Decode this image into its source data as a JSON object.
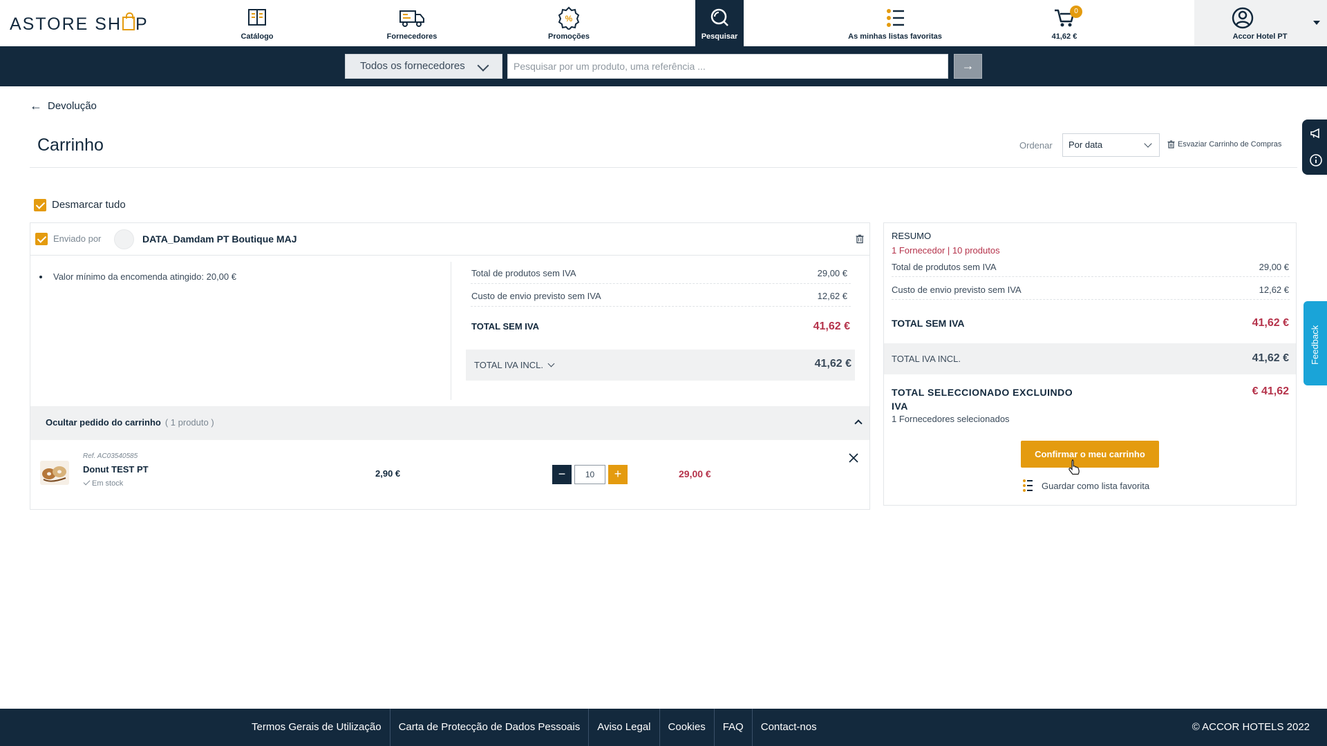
{
  "header": {
    "logo": "ASTORE SHOP",
    "nav": [
      {
        "label": "Catálogo",
        "icon": "catalog-book-icon"
      },
      {
        "label": "Fornecedores",
        "icon": "truck-icon"
      },
      {
        "label": "Promoções",
        "icon": "promo-badge-icon"
      },
      {
        "label": "Pesquisar",
        "icon": "search-icon",
        "active": true
      },
      {
        "label": "As minhas listas favoritas",
        "icon": "list-icon"
      },
      {
        "label": "41,62 €",
        "icon": "cart-icon",
        "badge": "0"
      }
    ],
    "account": {
      "label": "Accor Hotel PT",
      "icon": "user-circle-icon"
    }
  },
  "search": {
    "supplier_select": "Todos os fornecedores",
    "placeholder": "Pesquisar por um produto, uma referência ...",
    "value": "",
    "submit_icon": "arrow-right-icon"
  },
  "page": {
    "back_label": "Devolução",
    "title": "Carrinho",
    "sort_label": "Ordenar",
    "sort_value": "Por data",
    "empty_cart_label": "Esvaziar Carrinho de Compras",
    "select_all_label": "Desmarcar tudo"
  },
  "supplier_card": {
    "sent_by": "Enviado por",
    "supplier_name": "DATA_Damdam PT Boutique MAJ",
    "min_order_note": "Valor mínimo da encomenda atingido: 20,00 €",
    "rows": [
      {
        "label": "Total de produtos sem IVA",
        "value": "29,00 €"
      },
      {
        "label": "Custo de envio previsto sem IVA",
        "value": "12,62 €"
      }
    ],
    "total_label": "TOTAL SEM IVA",
    "total_value": "41,62 €",
    "vat_label": "TOTAL IVA INCL.",
    "vat_value": "41,62 €",
    "hide_label": "Ocultar pedido do carrinho",
    "hide_count": "( 1 produto )",
    "product": {
      "ref": "Ref. AC03540585",
      "name": "Donut TEST PT",
      "stock": "Em stock",
      "unit_price": "2,90 €",
      "quantity": "10",
      "total": "29,00 €"
    }
  },
  "summary": {
    "title": "RESUMO",
    "subtitle": "1 Fornecedor | 10 produtos",
    "rows": [
      {
        "label": "Total de produtos sem IVA",
        "value": "29,00 €"
      },
      {
        "label": "Custo de envio previsto sem IVA",
        "value": "12,62 €"
      }
    ],
    "total_label": "TOTAL SEM IVA",
    "total_value": "41,62 €",
    "vat_label": "TOTAL IVA INCL.",
    "vat_value": "41,62 €",
    "selected_label": "TOTAL SELECCIONADO EXCLUINDO IVA",
    "selected_value": "€ 41,62",
    "selected_note": "1 Fornecedores selecionados",
    "confirm_label": "Confirmar o meu carrinho",
    "save_label": "Guardar como lista favorita"
  },
  "side": {
    "feedback_label": "Feedback"
  },
  "footer": {
    "links": [
      "Termos Gerais de Utilização",
      "Carta de Protecção de Dados Pessoais",
      "Aviso Legal",
      "Cookies",
      "FAQ",
      "Contact-nos"
    ],
    "copyright": "© ACCOR HOTELS 2022"
  },
  "colors": {
    "navy": "#13293d",
    "accent": "#e49b0f",
    "price_red": "#b5334b",
    "panel_grey": "#f0f1f2"
  }
}
